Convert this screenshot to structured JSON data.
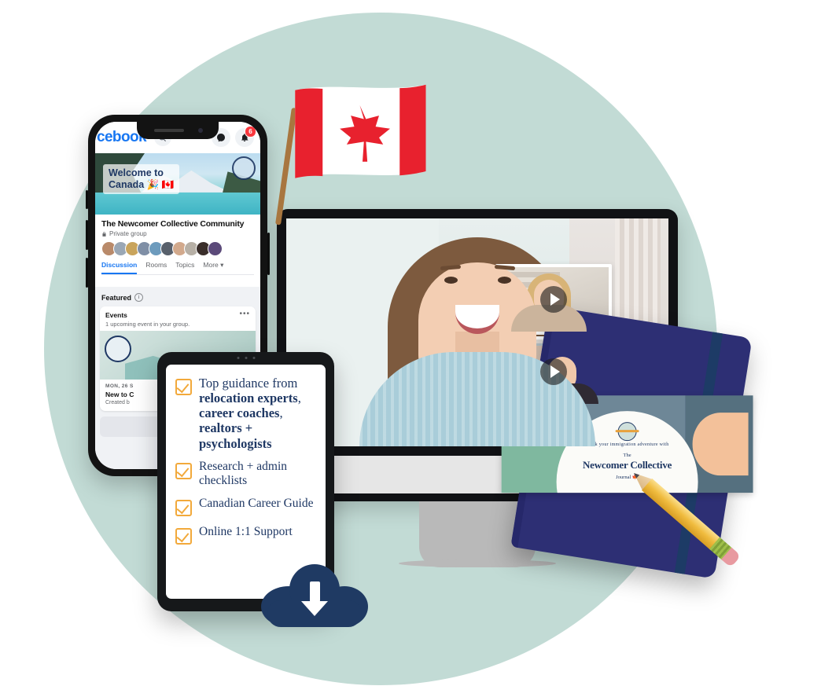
{
  "scene": {
    "title": "Newcomer Collective product bundle",
    "background_circle_color": "#c2dbd5",
    "brand_navy": "#1f3864",
    "brand_amber": "#f2a93b"
  },
  "phone": {
    "app_name": "cebook",
    "search_icon": "search-icon",
    "messenger_icon": "messenger-icon",
    "bell_icon": "bell-icon",
    "notification_count": "6",
    "cover": {
      "welcome_line1": "Welcome to",
      "welcome_line2": "Canada  🎉 🇨🇦"
    },
    "group": {
      "name": "The Newcomer Collective Community",
      "privacy": "Private group",
      "lock_icon": "lock-icon",
      "member_avatars": [
        "#b98a6a",
        "#9aa7b5",
        "#c9a45c",
        "#7f8fa6",
        "#6d9bbd",
        "#58606b",
        "#d2a98c",
        "#b7b0a6",
        "#3a2e2a",
        "#5c4a7a"
      ]
    },
    "tabs": [
      {
        "label": "Discussion",
        "active": true
      },
      {
        "label": "Rooms",
        "active": false
      },
      {
        "label": "Topics",
        "active": false
      },
      {
        "label": "More ▾",
        "active": false
      }
    ],
    "feed": {
      "featured_label": "Featured",
      "info_icon": "info-icon",
      "event_card": {
        "title": "Events",
        "subtitle": "1 upcoming event in your group.",
        "more_icon": "more-options-icon",
        "date": "MON, 26 S",
        "name": "New to C",
        "created_by": "Created b"
      }
    }
  },
  "tablet": {
    "checklist": [
      {
        "icon": "checkbox-checked-icon",
        "parts": [
          {
            "text": "Top guidance from ",
            "bold": false
          },
          {
            "text": "relocation experts",
            "bold": true
          },
          {
            "text": ", ",
            "bold": false
          },
          {
            "text": "career coaches",
            "bold": true
          },
          {
            "text": ", ",
            "bold": false
          },
          {
            "text": "realtors + psychologists",
            "bold": true
          }
        ]
      },
      {
        "icon": "checkbox-checked-icon",
        "parts": [
          {
            "text": "Research + admin checklists",
            "bold": false
          }
        ]
      },
      {
        "icon": "checkbox-checked-icon",
        "parts": [
          {
            "text": "Canadian Career Guide",
            "bold": false
          }
        ]
      },
      {
        "icon": "checkbox-checked-icon",
        "parts": [
          {
            "text": "Online 1:1 Support",
            "bold": false
          }
        ]
      }
    ]
  },
  "monitor": {
    "main_video_alt": "smiling woman in light blue sweater",
    "thumbnails": [
      {
        "alt": "blonde woman on video call",
        "play_icon": "play-icon"
      },
      {
        "alt": "dark haired woman on video call",
        "play_icon": "play-icon"
      }
    ]
  },
  "flag": {
    "name": "canadian-flag",
    "red": "#e8212e",
    "white": "#ffffff",
    "pole_color": "#a8763f"
  },
  "notebook": {
    "cover_color": "#2d2f74",
    "band": {
      "tagline": "Track your immigration adventure with",
      "the": "The",
      "title": "Newcomer Collective",
      "subtitle": "Journal 🍁",
      "globe_icon": "globe-icon"
    }
  },
  "pencil": {
    "name": "pencil",
    "body_color": "#f0bc3f",
    "eraser_color": "#e89aa0"
  },
  "download": {
    "icon": "cloud-download-icon",
    "color": "#1f3a63"
  }
}
